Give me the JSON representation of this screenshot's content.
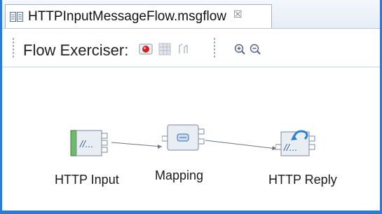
{
  "editor": {
    "tab_title": "HTTPInputMessageFlow.msgflow",
    "tab_close_glyph": "☒"
  },
  "toolbar": {
    "flow_exerciser_label": "Flow Exerciser:",
    "icons": [
      "record-icon",
      "grid-icon",
      "path-icon",
      "zoom-in-icon",
      "zoom-out-icon"
    ]
  },
  "flow": {
    "nodes": [
      {
        "label": "HTTP Input",
        "icon": "http-input-node-icon"
      },
      {
        "label": "Mapping",
        "icon": "mapping-node-icon"
      },
      {
        "label": "HTTP Reply",
        "icon": "http-reply-node-icon"
      }
    ],
    "connections": [
      {
        "from": "HTTP Input",
        "to": "Mapping"
      },
      {
        "from": "Mapping",
        "to": "HTTP Reply"
      }
    ]
  },
  "colors": {
    "frame_border": "#2a7bd7",
    "record_red": "#d42020",
    "input_green": "#6dbb6a",
    "node_fill": "#e9eef5"
  }
}
